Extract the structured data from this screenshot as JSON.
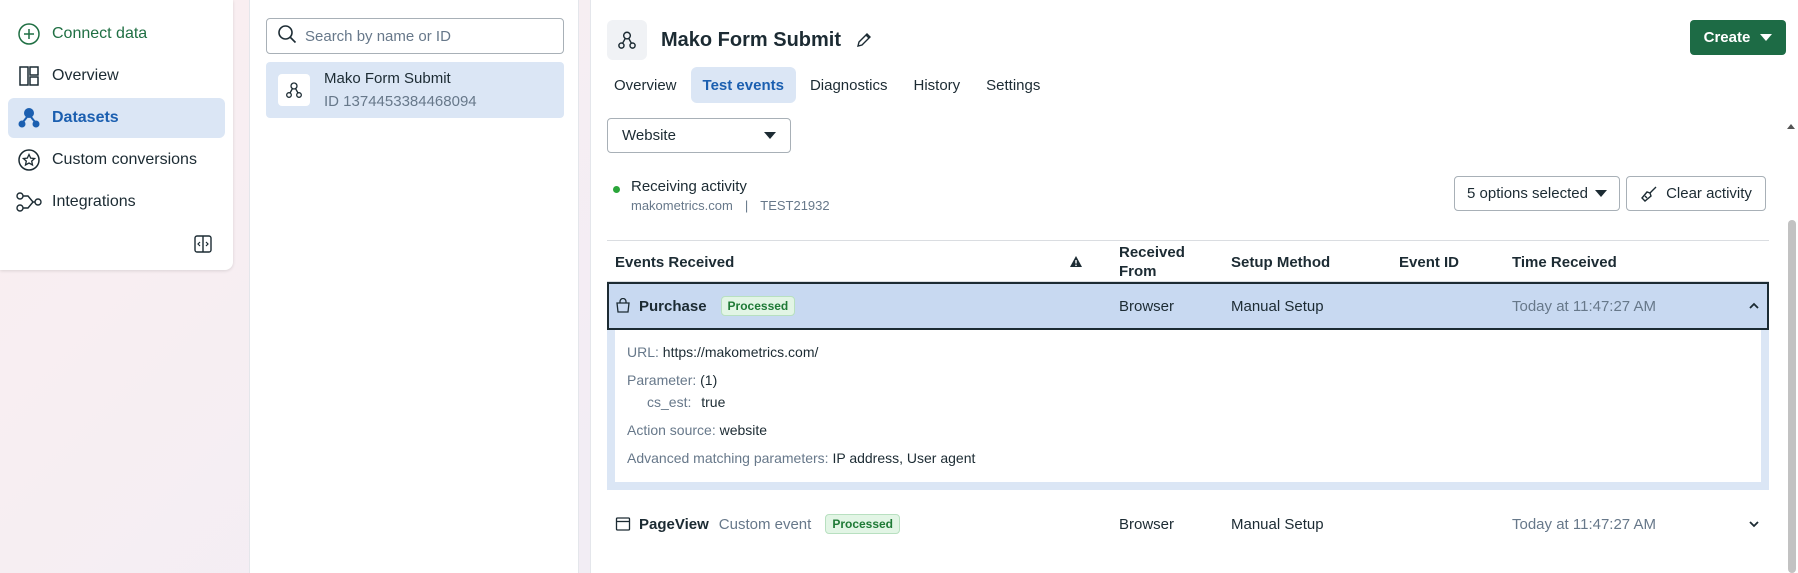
{
  "nav": {
    "connect_label": "Connect data",
    "items": [
      {
        "label": "Overview",
        "icon": "layout-icon"
      },
      {
        "label": "Datasets",
        "icon": "dataset-icon"
      },
      {
        "label": "Custom conversions",
        "icon": "star-icon"
      },
      {
        "label": "Integrations",
        "icon": "integrations-icon"
      }
    ]
  },
  "list": {
    "search_placeholder": "Search by name or ID",
    "dataset_name": "Mako Form Submit",
    "dataset_id": "ID 1374453384468094"
  },
  "header": {
    "title": "Mako Form Submit",
    "create_label": "Create"
  },
  "tabs": [
    "Overview",
    "Test events",
    "Diagnostics",
    "History",
    "Settings"
  ],
  "source_dropdown": "Website",
  "activity": {
    "status": "Receiving activity",
    "domain": "makometrics.com",
    "sep": "|",
    "code": "TEST21932"
  },
  "options_label": "5 options selected",
  "clear_label": "Clear activity",
  "table": {
    "headers": {
      "events": "Events Received",
      "received_from_1": "Received",
      "received_from_2": "From",
      "setup": "Setup Method",
      "event_id": "Event ID",
      "time": "Time Received"
    },
    "rows": [
      {
        "name": "Purchase",
        "badge": "Processed",
        "from": "Browser",
        "setup": "Manual Setup",
        "time": "Today at 11:47:27 AM",
        "details": {
          "url_label": "URL:",
          "url": "https://makometrics.com/",
          "param_label": "Parameter:",
          "param_count": "(1)",
          "param_key": "cs_est:",
          "param_value": "true",
          "action_label": "Action source:",
          "action": "website",
          "amp_label": "Advanced matching parameters:",
          "amp": "IP address, User agent"
        }
      },
      {
        "name": "PageView",
        "custom": "Custom event",
        "badge": "Processed",
        "from": "Browser",
        "setup": "Manual Setup",
        "time": "Today at 11:47:27 AM"
      }
    ]
  },
  "colors": {
    "accent": "#1b5fb0",
    "create": "#1d6b45",
    "status_dot": "#2aa53a"
  }
}
